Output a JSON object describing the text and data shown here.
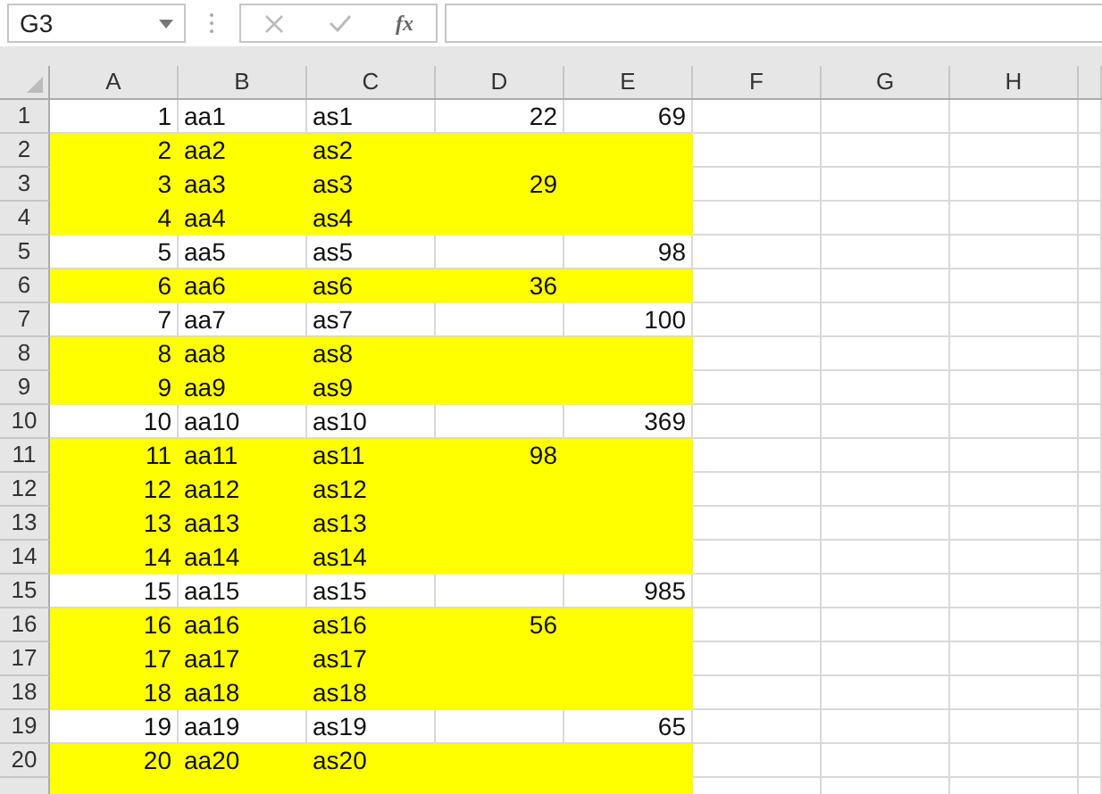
{
  "name_box": {
    "value": "G3"
  },
  "formula_bar": {
    "fx": "fx"
  },
  "columns": [
    "A",
    "B",
    "C",
    "D",
    "E",
    "F",
    "G",
    "H"
  ],
  "rows": [
    {
      "number": "1",
      "highlighted": false,
      "cells": [
        "1",
        "aa1",
        "as1",
        "22",
        "69"
      ]
    },
    {
      "number": "2",
      "highlighted": true,
      "cells": [
        "2",
        "aa2",
        "as2",
        "",
        ""
      ]
    },
    {
      "number": "3",
      "highlighted": true,
      "cells": [
        "3",
        "aa3",
        "as3",
        "29",
        ""
      ]
    },
    {
      "number": "4",
      "highlighted": true,
      "cells": [
        "4",
        "aa4",
        "as4",
        "",
        ""
      ]
    },
    {
      "number": "5",
      "highlighted": false,
      "cells": [
        "5",
        "aa5",
        "as5",
        "",
        "98"
      ]
    },
    {
      "number": "6",
      "highlighted": true,
      "cells": [
        "6",
        "aa6",
        "as6",
        "36",
        ""
      ]
    },
    {
      "number": "7",
      "highlighted": false,
      "cells": [
        "7",
        "aa7",
        "as7",
        "",
        "100"
      ]
    },
    {
      "number": "8",
      "highlighted": true,
      "cells": [
        "8",
        "aa8",
        "as8",
        "",
        ""
      ]
    },
    {
      "number": "9",
      "highlighted": true,
      "cells": [
        "9",
        "aa9",
        "as9",
        "",
        ""
      ]
    },
    {
      "number": "10",
      "highlighted": false,
      "cells": [
        "10",
        "aa10",
        "as10",
        "",
        "369"
      ]
    },
    {
      "number": "11",
      "highlighted": true,
      "cells": [
        "11",
        "aa11",
        "as11",
        "98",
        ""
      ]
    },
    {
      "number": "12",
      "highlighted": true,
      "cells": [
        "12",
        "aa12",
        "as12",
        "",
        ""
      ]
    },
    {
      "number": "13",
      "highlighted": true,
      "cells": [
        "13",
        "aa13",
        "as13",
        "",
        ""
      ]
    },
    {
      "number": "14",
      "highlighted": true,
      "cells": [
        "14",
        "aa14",
        "as14",
        "",
        ""
      ]
    },
    {
      "number": "15",
      "highlighted": false,
      "cells": [
        "15",
        "aa15",
        "as15",
        "",
        "985"
      ]
    },
    {
      "number": "16",
      "highlighted": true,
      "cells": [
        "16",
        "aa16",
        "as16",
        "56",
        ""
      ]
    },
    {
      "number": "17",
      "highlighted": true,
      "cells": [
        "17",
        "aa17",
        "as17",
        "",
        ""
      ]
    },
    {
      "number": "18",
      "highlighted": true,
      "cells": [
        "18",
        "aa18",
        "as18",
        "",
        ""
      ]
    },
    {
      "number": "19",
      "highlighted": false,
      "cells": [
        "19",
        "aa19",
        "as19",
        "",
        "65"
      ]
    },
    {
      "number": "20",
      "highlighted": true,
      "cells": [
        "20",
        "aa20",
        "as20",
        "",
        ""
      ]
    },
    {
      "highlighted": true
    }
  ]
}
